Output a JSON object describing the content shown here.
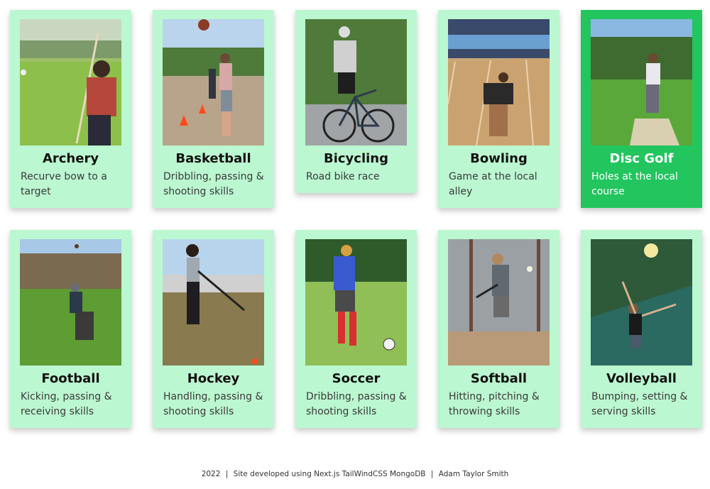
{
  "cards": [
    {
      "title": "Archery",
      "desc": "Recurve bow to a target",
      "icon": "archery-photo"
    },
    {
      "title": "Basketball",
      "desc": "Dribbling, passing & shooting skills",
      "icon": "basketball-photo"
    },
    {
      "title": "Bicycling",
      "desc": "Road bike race",
      "icon": "bicycling-photo"
    },
    {
      "title": "Bowling",
      "desc": "Game at the local alley",
      "icon": "bowling-photo"
    },
    {
      "title": "Disc Golf",
      "desc": "Holes at the local course",
      "icon": "disc-golf-photo"
    },
    {
      "title": "Football",
      "desc": "Kicking, passing & receiving skills",
      "icon": "football-photo"
    },
    {
      "title": "Hockey",
      "desc": "Handling, passing & shooting skills",
      "icon": "hockey-photo"
    },
    {
      "title": "Soccer",
      "desc": "Dribbling, passing & shooting skills",
      "icon": "soccer-photo"
    },
    {
      "title": "Softball",
      "desc": "Hitting, pitching & throwing skills",
      "icon": "softball-photo"
    },
    {
      "title": "Volleyball",
      "desc": "Bumping, setting & serving skills",
      "icon": "volleyball-photo"
    }
  ],
  "active_card": "Disc Golf",
  "colors": {
    "card_bg": "#bbf7d0",
    "card_active_bg": "#22c55e"
  },
  "footer": {
    "year": "2022",
    "sep1": "|",
    "credits": "Site developed using Next.js TailWindCSS MongoDB",
    "sep2": "|",
    "author": "Adam Taylor Smith"
  }
}
